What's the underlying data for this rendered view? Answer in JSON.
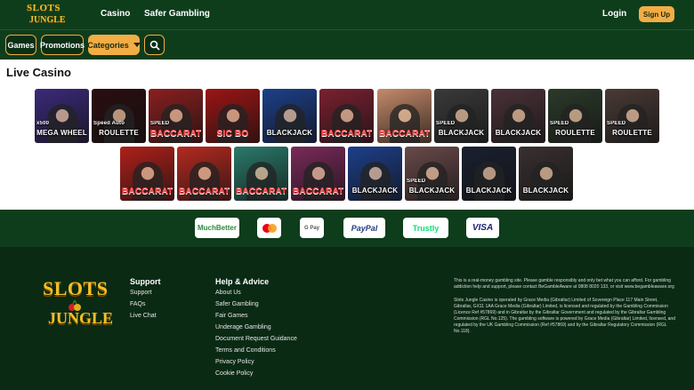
{
  "brand": {
    "logo_line1": "SLOTS",
    "logo_line2": "JUNGLE"
  },
  "header": {
    "nav": [
      "Casino",
      "Safer Gambling"
    ],
    "login_label": "Login",
    "signup_label": "Sign Up"
  },
  "navbar": {
    "games_label": "Games",
    "promotions_label": "Promotions",
    "categories_label": "Categories"
  },
  "section_title": "Live Casino",
  "games": [
    {
      "name": "MEGA WHEEL",
      "tag": "x500",
      "bg": "#3b2a7a"
    },
    {
      "name": "ROULETTE",
      "tag": "Speed Auto",
      "bg": "#2a0e10"
    },
    {
      "name": "BACCARAT",
      "tag": "SPEED",
      "bg": "#8a1f1f"
    },
    {
      "name": "SIC BO",
      "tag": "",
      "bg": "#9c1515"
    },
    {
      "name": "BLACKJACK",
      "tag": "",
      "bg": "#1d3f8a"
    },
    {
      "name": "BACCARAT",
      "tag": "",
      "bg": "#7a2030"
    },
    {
      "name": "BACCARAT",
      "tag": "",
      "bg": "#c58a6a"
    },
    {
      "name": "BLACKJACK",
      "tag": "SPEED",
      "bg": "#3a3a3a"
    },
    {
      "name": "BLACKJACK",
      "tag": "",
      "bg": "#4a3238"
    },
    {
      "name": "ROULETTE",
      "tag": "SPEED",
      "bg": "#2b3a2a"
    },
    {
      "name": "ROULETTE",
      "tag": "SPEED",
      "bg": "#4a3a35"
    },
    {
      "name": "BACCARAT",
      "tag": "",
      "bg": "#b0201a"
    },
    {
      "name": "BACCARAT",
      "tag": "",
      "bg": "#b52a20"
    },
    {
      "name": "BACCARAT",
      "tag": "",
      "bg": "#2a7a6a"
    },
    {
      "name": "BACCARAT",
      "tag": "",
      "bg": "#7a2a5a"
    },
    {
      "name": "BLACKJACK",
      "tag": "",
      "bg": "#1d3f8a"
    },
    {
      "name": "BLACKJACK",
      "tag": "SPEED",
      "bg": "#6a4a4a"
    },
    {
      "name": "BLACKJACK",
      "tag": "",
      "bg": "#1a2030"
    },
    {
      "name": "BLACKJACK",
      "tag": "",
      "bg": "#3a3030"
    }
  ],
  "payments": [
    "MuchBetter",
    "Mastercard",
    "G Pay",
    "PayPal",
    "Trustly",
    "VISA"
  ],
  "footer": {
    "support_heading": "Support",
    "support_links": [
      "Support",
      "FAQs",
      "Live Chat"
    ],
    "help_heading": "Help & Advice",
    "help_links": [
      "About Us",
      "Safer Gambling",
      "Fair Games",
      "Underage Gambling",
      "Document Request Guidance",
      "Terms and Conditions",
      "Privacy Policy",
      "Cookie Policy"
    ],
    "legal_1": "This is a real-money gambling site. Please gamble responsibly and only bet what you can afford. For gambling addiction help and support, please contact BeGambleAware at 0808 8020 133, or visit www.begambleaware.org",
    "legal_2": "Slots Jungle Casino is operated by Grace Media (Gibraltar) Limited of Sovereign Place 117 Main Street, Gibraltar, GX11 1AA Grace Media (Gibraltar) Limited, is licensed and regulated by the Gambling Commission (Licence Ref #57869) and in Gibraltar by the Gibraltar Government and regulated by the Gibraltar Gambling Commission (RGL No.125). The gambling software is powered by Grace Media (Gibraltar) Limited, licensed, and regulated by the UK Gambling Commission (Ref #57869) and by the Gibraltar Regulatory Commission (RGL No.118)."
  }
}
